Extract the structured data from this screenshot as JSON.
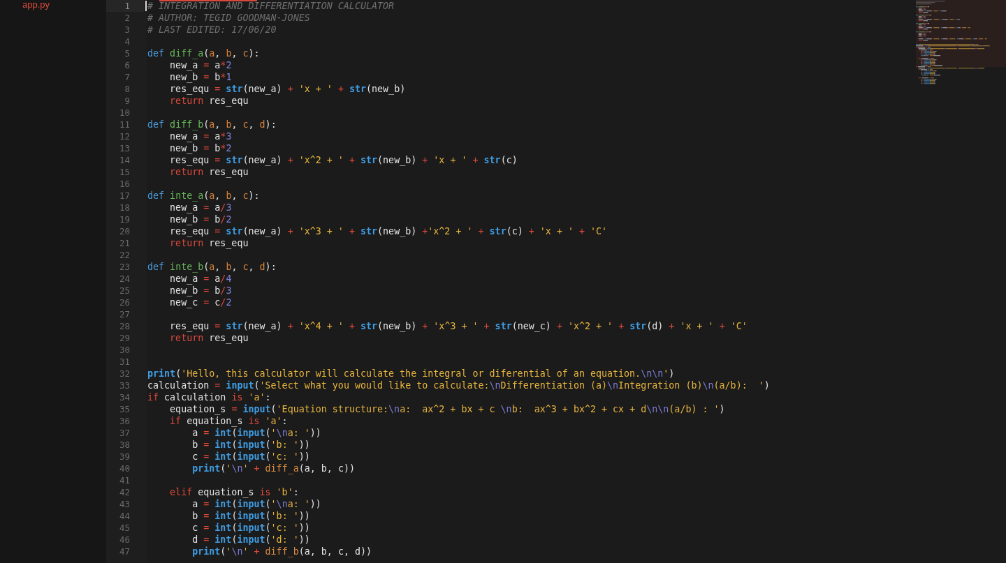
{
  "sidebar": {
    "files": [
      {
        "name": "app.py"
      }
    ]
  },
  "editor": {
    "lines": [
      {
        "number": "1",
        "current": true,
        "tokens": [
          {
            "kind": "comment",
            "text": "# INTEGRATION AND DIFFERENTIATION CALCULATOR"
          }
        ]
      },
      {
        "number": "2",
        "current": false,
        "tokens": [
          {
            "kind": "comment",
            "text": "# AUTHOR: TEGID GOODMAN-JONES"
          }
        ]
      },
      {
        "number": "3",
        "current": false,
        "tokens": [
          {
            "kind": "comment",
            "text": "# LAST EDITED: 17/06/20"
          }
        ]
      },
      {
        "number": "4",
        "current": false
      },
      {
        "number": "5",
        "current": false,
        "tokens": [
          {
            "kind": "storage",
            "text": "def "
          },
          {
            "kind": "function",
            "text": "diff_a"
          },
          {
            "kind": "plain",
            "text": "("
          },
          {
            "kind": "param",
            "text": "a"
          },
          {
            "kind": "plain",
            "text": ", "
          },
          {
            "kind": "param",
            "text": "b"
          },
          {
            "kind": "plain",
            "text": ", "
          },
          {
            "kind": "param",
            "text": "c"
          },
          {
            "kind": "plain",
            "text": "):"
          }
        ]
      },
      {
        "number": "6",
        "current": false,
        "tokens": [
          {
            "kind": "plain",
            "text": "    new_a "
          },
          {
            "kind": "operator",
            "text": "="
          },
          {
            "kind": "plain",
            "text": " a"
          },
          {
            "kind": "operator",
            "text": "*"
          },
          {
            "kind": "number",
            "text": "2"
          }
        ]
      },
      {
        "number": "7",
        "current": false,
        "tokens": [
          {
            "kind": "plain",
            "text": "    new_b "
          },
          {
            "kind": "operator",
            "text": "="
          },
          {
            "kind": "plain",
            "text": " b"
          },
          {
            "kind": "operator",
            "text": "*"
          },
          {
            "kind": "number",
            "text": "1"
          }
        ]
      },
      {
        "number": "8",
        "current": false,
        "tokens": [
          {
            "kind": "plain",
            "text": "    res_equ "
          },
          {
            "kind": "operator",
            "text": "= "
          },
          {
            "kind": "builtin",
            "text": "str"
          },
          {
            "kind": "plain",
            "text": "(new_a) "
          },
          {
            "kind": "operator",
            "text": "+ "
          },
          {
            "kind": "string",
            "text": "'x + ' "
          },
          {
            "kind": "operator",
            "text": "+ "
          },
          {
            "kind": "builtin",
            "text": "str"
          },
          {
            "kind": "plain",
            "text": "(new_b)"
          }
        ]
      },
      {
        "number": "9",
        "current": false,
        "tokens": [
          {
            "kind": "keyword",
            "text": "    return"
          },
          {
            "kind": "plain",
            "text": " res_equ"
          }
        ]
      },
      {
        "number": "10",
        "current": false
      },
      {
        "number": "11",
        "current": false,
        "tokens": [
          {
            "kind": "storage",
            "text": "def "
          },
          {
            "kind": "function",
            "text": "diff_b"
          },
          {
            "kind": "plain",
            "text": "("
          },
          {
            "kind": "param",
            "text": "a"
          },
          {
            "kind": "plain",
            "text": ", "
          },
          {
            "kind": "param",
            "text": "b"
          },
          {
            "kind": "plain",
            "text": ", "
          },
          {
            "kind": "param",
            "text": "c"
          },
          {
            "kind": "plain",
            "text": ", "
          },
          {
            "kind": "param",
            "text": "d"
          },
          {
            "kind": "plain",
            "text": "):"
          }
        ]
      },
      {
        "number": "12",
        "current": false,
        "tokens": [
          {
            "kind": "plain",
            "text": "    new_a "
          },
          {
            "kind": "operator",
            "text": "="
          },
          {
            "kind": "plain",
            "text": " a"
          },
          {
            "kind": "operator",
            "text": "*"
          },
          {
            "kind": "number",
            "text": "3"
          }
        ]
      },
      {
        "number": "13",
        "current": false,
        "tokens": [
          {
            "kind": "plain",
            "text": "    new_b "
          },
          {
            "kind": "operator",
            "text": "="
          },
          {
            "kind": "plain",
            "text": " b"
          },
          {
            "kind": "operator",
            "text": "*"
          },
          {
            "kind": "number",
            "text": "2"
          }
        ]
      },
      {
        "number": "14",
        "current": false,
        "tokens": [
          {
            "kind": "plain",
            "text": "    res_equ "
          },
          {
            "kind": "operator",
            "text": "= "
          },
          {
            "kind": "builtin",
            "text": "str"
          },
          {
            "kind": "plain",
            "text": "(new_a) "
          },
          {
            "kind": "operator",
            "text": "+ "
          },
          {
            "kind": "string",
            "text": "'x^2 + ' "
          },
          {
            "kind": "operator",
            "text": "+ "
          },
          {
            "kind": "builtin",
            "text": "str"
          },
          {
            "kind": "plain",
            "text": "(new_b) "
          },
          {
            "kind": "operator",
            "text": "+ "
          },
          {
            "kind": "string",
            "text": "'x + ' "
          },
          {
            "kind": "operator",
            "text": "+ "
          },
          {
            "kind": "builtin",
            "text": "str"
          },
          {
            "kind": "plain",
            "text": "(c)"
          }
        ]
      },
      {
        "number": "15",
        "current": false,
        "tokens": [
          {
            "kind": "keyword",
            "text": "    return"
          },
          {
            "kind": "plain",
            "text": " res_equ"
          }
        ]
      },
      {
        "number": "16",
        "current": false
      },
      {
        "number": "17",
        "current": false,
        "tokens": [
          {
            "kind": "storage",
            "text": "def "
          },
          {
            "kind": "function",
            "text": "inte_a"
          },
          {
            "kind": "plain",
            "text": "("
          },
          {
            "kind": "param",
            "text": "a"
          },
          {
            "kind": "plain",
            "text": ", "
          },
          {
            "kind": "param",
            "text": "b"
          },
          {
            "kind": "plain",
            "text": ", "
          },
          {
            "kind": "param",
            "text": "c"
          },
          {
            "kind": "plain",
            "text": "):"
          }
        ]
      },
      {
        "number": "18",
        "current": false,
        "tokens": [
          {
            "kind": "plain",
            "text": "    new_a "
          },
          {
            "kind": "operator",
            "text": "="
          },
          {
            "kind": "plain",
            "text": " a"
          },
          {
            "kind": "operator",
            "text": "/"
          },
          {
            "kind": "number",
            "text": "3"
          }
        ]
      },
      {
        "number": "19",
        "current": false,
        "tokens": [
          {
            "kind": "plain",
            "text": "    new_b "
          },
          {
            "kind": "operator",
            "text": "="
          },
          {
            "kind": "plain",
            "text": " b"
          },
          {
            "kind": "operator",
            "text": "/"
          },
          {
            "kind": "number",
            "text": "2"
          }
        ]
      },
      {
        "number": "20",
        "current": false,
        "tokens": [
          {
            "kind": "plain",
            "text": "    res_equ "
          },
          {
            "kind": "operator",
            "text": "= "
          },
          {
            "kind": "builtin",
            "text": "str"
          },
          {
            "kind": "plain",
            "text": "(new_a) "
          },
          {
            "kind": "operator",
            "text": "+ "
          },
          {
            "kind": "string",
            "text": "'x^3 + ' "
          },
          {
            "kind": "operator",
            "text": "+ "
          },
          {
            "kind": "builtin",
            "text": "str"
          },
          {
            "kind": "plain",
            "text": "(new_b) "
          },
          {
            "kind": "operator",
            "text": "+"
          },
          {
            "kind": "string",
            "text": "'x^2 + ' "
          },
          {
            "kind": "operator",
            "text": "+ "
          },
          {
            "kind": "builtin",
            "text": "str"
          },
          {
            "kind": "plain",
            "text": "(c) "
          },
          {
            "kind": "operator",
            "text": "+ "
          },
          {
            "kind": "string",
            "text": "'x + ' "
          },
          {
            "kind": "operator",
            "text": "+ "
          },
          {
            "kind": "string",
            "text": "'C'"
          }
        ]
      },
      {
        "number": "21",
        "current": false,
        "tokens": [
          {
            "kind": "keyword",
            "text": "    return"
          },
          {
            "kind": "plain",
            "text": " res_equ"
          }
        ]
      },
      {
        "number": "22",
        "current": false
      },
      {
        "number": "23",
        "current": false,
        "tokens": [
          {
            "kind": "storage",
            "text": "def "
          },
          {
            "kind": "function",
            "text": "inte_b"
          },
          {
            "kind": "plain",
            "text": "("
          },
          {
            "kind": "param",
            "text": "a"
          },
          {
            "kind": "plain",
            "text": ", "
          },
          {
            "kind": "param",
            "text": "b"
          },
          {
            "kind": "plain",
            "text": ", "
          },
          {
            "kind": "param",
            "text": "c"
          },
          {
            "kind": "plain",
            "text": ", "
          },
          {
            "kind": "param",
            "text": "d"
          },
          {
            "kind": "plain",
            "text": "):"
          }
        ]
      },
      {
        "number": "24",
        "current": false,
        "tokens": [
          {
            "kind": "plain",
            "text": "    new_a "
          },
          {
            "kind": "operator",
            "text": "="
          },
          {
            "kind": "plain",
            "text": " a"
          },
          {
            "kind": "operator",
            "text": "/"
          },
          {
            "kind": "number",
            "text": "4"
          }
        ]
      },
      {
        "number": "25",
        "current": false,
        "tokens": [
          {
            "kind": "plain",
            "text": "    new_b "
          },
          {
            "kind": "operator",
            "text": "="
          },
          {
            "kind": "plain",
            "text": " b"
          },
          {
            "kind": "operator",
            "text": "/"
          },
          {
            "kind": "number",
            "text": "3"
          }
        ]
      },
      {
        "number": "26",
        "current": false,
        "tokens": [
          {
            "kind": "plain",
            "text": "    new_c "
          },
          {
            "kind": "operator",
            "text": "="
          },
          {
            "kind": "plain",
            "text": " c"
          },
          {
            "kind": "operator",
            "text": "/"
          },
          {
            "kind": "number",
            "text": "2"
          }
        ]
      },
      {
        "number": "27",
        "current": false
      },
      {
        "number": "28",
        "current": false,
        "tokens": [
          {
            "kind": "plain",
            "text": "    res_equ "
          },
          {
            "kind": "operator",
            "text": "= "
          },
          {
            "kind": "builtin",
            "text": "str"
          },
          {
            "kind": "plain",
            "text": "(new_a) "
          },
          {
            "kind": "operator",
            "text": "+ "
          },
          {
            "kind": "string",
            "text": "'x^4 + ' "
          },
          {
            "kind": "operator",
            "text": "+ "
          },
          {
            "kind": "builtin",
            "text": "str"
          },
          {
            "kind": "plain",
            "text": "(new_b) "
          },
          {
            "kind": "operator",
            "text": "+ "
          },
          {
            "kind": "string",
            "text": "'x^3 + ' "
          },
          {
            "kind": "operator",
            "text": "+ "
          },
          {
            "kind": "builtin",
            "text": "str"
          },
          {
            "kind": "plain",
            "text": "(new_c) "
          },
          {
            "kind": "operator",
            "text": "+ "
          },
          {
            "kind": "string",
            "text": "'x^2 + ' "
          },
          {
            "kind": "operator",
            "text": "+ "
          },
          {
            "kind": "builtin",
            "text": "str"
          },
          {
            "kind": "plain",
            "text": "(d) "
          },
          {
            "kind": "operator",
            "text": "+ "
          },
          {
            "kind": "string",
            "text": "'x + ' "
          },
          {
            "kind": "operator",
            "text": "+ "
          },
          {
            "kind": "string",
            "text": "'C'"
          }
        ]
      },
      {
        "number": "29",
        "current": false,
        "tokens": [
          {
            "kind": "keyword",
            "text": "    return"
          },
          {
            "kind": "plain",
            "text": " res_equ"
          }
        ]
      },
      {
        "number": "30",
        "current": false
      },
      {
        "number": "31",
        "current": false
      },
      {
        "number": "32",
        "current": false,
        "tokens": [
          {
            "kind": "builtin",
            "text": "print"
          },
          {
            "kind": "plain",
            "text": "("
          },
          {
            "kind": "string",
            "text": "'Hello, this calculator will calculate the integral or diferential of an equation."
          },
          {
            "kind": "escape",
            "text": "\\n\\n"
          },
          {
            "kind": "string",
            "text": "'"
          },
          {
            "kind": "plain",
            "text": ")"
          }
        ]
      },
      {
        "number": "33",
        "current": false,
        "tokens": [
          {
            "kind": "plain",
            "text": "calculation "
          },
          {
            "kind": "operator",
            "text": "= "
          },
          {
            "kind": "builtin",
            "text": "input"
          },
          {
            "kind": "plain",
            "text": "("
          },
          {
            "kind": "string",
            "text": "'Select what you would like to calculate:"
          },
          {
            "kind": "escape",
            "text": "\\n"
          },
          {
            "kind": "string",
            "text": "Differentiation (a)"
          },
          {
            "kind": "escape",
            "text": "\\n"
          },
          {
            "kind": "string",
            "text": "Integration (b)"
          },
          {
            "kind": "escape",
            "text": "\\n"
          },
          {
            "kind": "string",
            "text": "(a/b):  '"
          },
          {
            "kind": "plain",
            "text": ")"
          }
        ]
      },
      {
        "number": "34",
        "current": false,
        "tokens": [
          {
            "kind": "keyword",
            "text": "if"
          },
          {
            "kind": "plain",
            "text": " calculation "
          },
          {
            "kind": "keyword",
            "text": "is "
          },
          {
            "kind": "string",
            "text": "'a'"
          },
          {
            "kind": "plain",
            "text": ":"
          }
        ]
      },
      {
        "number": "35",
        "current": false,
        "tokens": [
          {
            "kind": "plain",
            "text": "    equation_s "
          },
          {
            "kind": "operator",
            "text": "= "
          },
          {
            "kind": "builtin",
            "text": "input"
          },
          {
            "kind": "plain",
            "text": "("
          },
          {
            "kind": "string",
            "text": "'Equation structure:"
          },
          {
            "kind": "escape",
            "text": "\\n"
          },
          {
            "kind": "string",
            "text": "a:  ax^2 + bx + c "
          },
          {
            "kind": "escape",
            "text": "\\n"
          },
          {
            "kind": "string",
            "text": "b:  ax^3 + bx^2 + cx + d"
          },
          {
            "kind": "escape",
            "text": "\\n\\n"
          },
          {
            "kind": "string",
            "text": "(a/b) : '"
          },
          {
            "kind": "plain",
            "text": ")"
          }
        ]
      },
      {
        "number": "36",
        "current": false,
        "tokens": [
          {
            "kind": "keyword",
            "text": "    if"
          },
          {
            "kind": "plain",
            "text": " equation_s "
          },
          {
            "kind": "keyword",
            "text": "is "
          },
          {
            "kind": "string",
            "text": "'a'"
          },
          {
            "kind": "plain",
            "text": ":"
          }
        ]
      },
      {
        "number": "37",
        "current": false,
        "tokens": [
          {
            "kind": "plain",
            "text": "        a "
          },
          {
            "kind": "operator",
            "text": "= "
          },
          {
            "kind": "builtin",
            "text": "int"
          },
          {
            "kind": "plain",
            "text": "("
          },
          {
            "kind": "builtin",
            "text": "input"
          },
          {
            "kind": "plain",
            "text": "("
          },
          {
            "kind": "string",
            "text": "'"
          },
          {
            "kind": "escape",
            "text": "\\n"
          },
          {
            "kind": "string",
            "text": "a: '"
          },
          {
            "kind": "plain",
            "text": "))"
          }
        ]
      },
      {
        "number": "38",
        "current": false,
        "tokens": [
          {
            "kind": "plain",
            "text": "        b "
          },
          {
            "kind": "operator",
            "text": "= "
          },
          {
            "kind": "builtin",
            "text": "int"
          },
          {
            "kind": "plain",
            "text": "("
          },
          {
            "kind": "builtin",
            "text": "input"
          },
          {
            "kind": "plain",
            "text": "("
          },
          {
            "kind": "string",
            "text": "'b: '"
          },
          {
            "kind": "plain",
            "text": "))"
          }
        ]
      },
      {
        "number": "39",
        "current": false,
        "tokens": [
          {
            "kind": "plain",
            "text": "        c "
          },
          {
            "kind": "operator",
            "text": "= "
          },
          {
            "kind": "builtin",
            "text": "int"
          },
          {
            "kind": "plain",
            "text": "("
          },
          {
            "kind": "builtin",
            "text": "input"
          },
          {
            "kind": "plain",
            "text": "("
          },
          {
            "kind": "string",
            "text": "'c: '"
          },
          {
            "kind": "plain",
            "text": "))"
          }
        ]
      },
      {
        "number": "40",
        "current": false,
        "tokens": [
          {
            "kind": "builtin",
            "text": "        print"
          },
          {
            "kind": "plain",
            "text": "("
          },
          {
            "kind": "string",
            "text": "'"
          },
          {
            "kind": "escape",
            "text": "\\n"
          },
          {
            "kind": "string",
            "text": "' "
          },
          {
            "kind": "operator",
            "text": "+ "
          },
          {
            "kind": "call",
            "text": "diff_a"
          },
          {
            "kind": "plain",
            "text": "(a, b, c))"
          }
        ]
      },
      {
        "number": "41",
        "current": false
      },
      {
        "number": "42",
        "current": false,
        "tokens": [
          {
            "kind": "keyword",
            "text": "    elif"
          },
          {
            "kind": "plain",
            "text": " equation_s "
          },
          {
            "kind": "keyword",
            "text": "is "
          },
          {
            "kind": "string",
            "text": "'b'"
          },
          {
            "kind": "plain",
            "text": ":"
          }
        ]
      },
      {
        "number": "43",
        "current": false,
        "tokens": [
          {
            "kind": "plain",
            "text": "        a "
          },
          {
            "kind": "operator",
            "text": "= "
          },
          {
            "kind": "builtin",
            "text": "int"
          },
          {
            "kind": "plain",
            "text": "("
          },
          {
            "kind": "builtin",
            "text": "input"
          },
          {
            "kind": "plain",
            "text": "("
          },
          {
            "kind": "string",
            "text": "'"
          },
          {
            "kind": "escape",
            "text": "\\n"
          },
          {
            "kind": "string",
            "text": "a: '"
          },
          {
            "kind": "plain",
            "text": "))"
          }
        ]
      },
      {
        "number": "44",
        "current": false,
        "tokens": [
          {
            "kind": "plain",
            "text": "        b "
          },
          {
            "kind": "operator",
            "text": "= "
          },
          {
            "kind": "builtin",
            "text": "int"
          },
          {
            "kind": "plain",
            "text": "("
          },
          {
            "kind": "builtin",
            "text": "input"
          },
          {
            "kind": "plain",
            "text": "("
          },
          {
            "kind": "string",
            "text": "'b: '"
          },
          {
            "kind": "plain",
            "text": "))"
          }
        ]
      },
      {
        "number": "45",
        "current": false,
        "tokens": [
          {
            "kind": "plain",
            "text": "        c "
          },
          {
            "kind": "operator",
            "text": "= "
          },
          {
            "kind": "builtin",
            "text": "int"
          },
          {
            "kind": "plain",
            "text": "("
          },
          {
            "kind": "builtin",
            "text": "input"
          },
          {
            "kind": "plain",
            "text": "("
          },
          {
            "kind": "string",
            "text": "'c: '"
          },
          {
            "kind": "plain",
            "text": "))"
          }
        ]
      },
      {
        "number": "46",
        "current": false,
        "tokens": [
          {
            "kind": "plain",
            "text": "        d "
          },
          {
            "kind": "operator",
            "text": "= "
          },
          {
            "kind": "builtin",
            "text": "int"
          },
          {
            "kind": "plain",
            "text": "("
          },
          {
            "kind": "builtin",
            "text": "input"
          },
          {
            "kind": "plain",
            "text": "("
          },
          {
            "kind": "string",
            "text": "'d: '"
          },
          {
            "kind": "plain",
            "text": "))"
          }
        ]
      },
      {
        "number": "47",
        "current": false,
        "tokens": [
          {
            "kind": "builtin",
            "text": "        print"
          },
          {
            "kind": "plain",
            "text": "("
          },
          {
            "kind": "string",
            "text": "'"
          },
          {
            "kind": "escape",
            "text": "\\n"
          },
          {
            "kind": "string",
            "text": "' "
          },
          {
            "kind": "operator",
            "text": "+ "
          },
          {
            "kind": "call",
            "text": "diff_b"
          },
          {
            "kind": "plain",
            "text": "(a, b, c, d))"
          }
        ]
      }
    ]
  }
}
